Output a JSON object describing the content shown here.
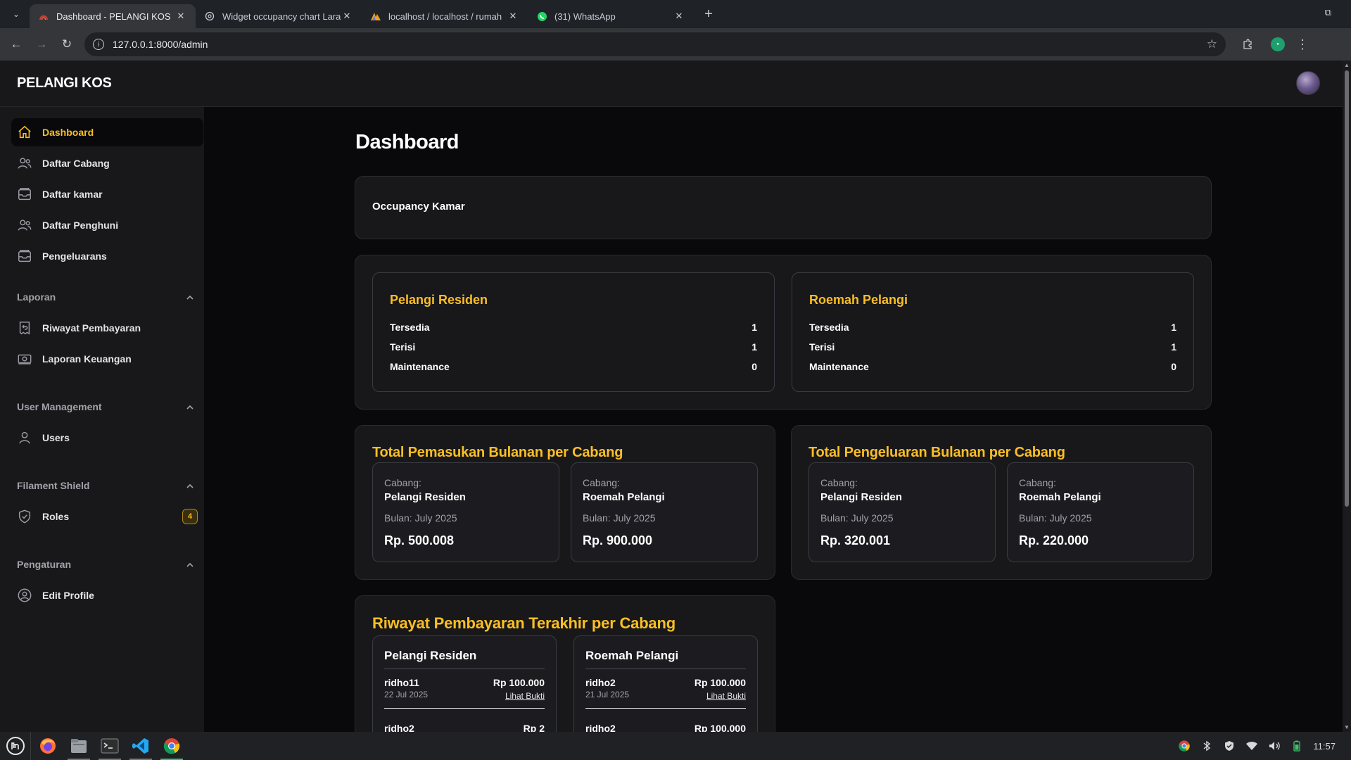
{
  "browser": {
    "tabs": [
      {
        "title": "Dashboard - PELANGI KOS",
        "icon": "pelangi-favicon",
        "active": true
      },
      {
        "title": "Widget occupancy chart Lara",
        "icon": "globe-icon",
        "active": false
      },
      {
        "title": "localhost / localhost / rumah",
        "icon": "phpmyadmin-icon",
        "active": false
      },
      {
        "title": "(31) WhatsApp",
        "icon": "whatsapp-icon",
        "active": false
      }
    ],
    "url": "127.0.0.1:8000/admin"
  },
  "app": {
    "brand": "PELANGI KOS",
    "accent": "#fbbf24"
  },
  "sidebar": {
    "items": [
      {
        "label": "Dashboard",
        "icon": "home-icon"
      },
      {
        "label": "Daftar Cabang",
        "icon": "users-icon"
      },
      {
        "label": "Daftar kamar",
        "icon": "inbox-icon"
      },
      {
        "label": "Daftar Penghuni",
        "icon": "users-icon"
      },
      {
        "label": "Pengeluarans",
        "icon": "inbox-icon"
      }
    ],
    "groups": [
      {
        "label": "Laporan",
        "items": [
          {
            "label": "Riwayat Pembayaran",
            "icon": "receipt-refund-icon"
          },
          {
            "label": "Laporan Keuangan",
            "icon": "banknotes-icon"
          }
        ]
      },
      {
        "label": "User Management",
        "items": [
          {
            "label": "Users",
            "icon": "user-icon"
          }
        ]
      },
      {
        "label": "Filament Shield",
        "items": [
          {
            "label": "Roles",
            "icon": "shield-check-icon",
            "badge": "4"
          }
        ]
      },
      {
        "label": "Pengaturan",
        "items": [
          {
            "label": "Edit Profile",
            "icon": "user-circle-icon"
          }
        ]
      }
    ]
  },
  "main": {
    "title": "Dashboard",
    "occupancy": {
      "title": "Occupancy Kamar",
      "branches": [
        {
          "name": "Pelangi Residen",
          "stats": [
            {
              "label": "Tersedia",
              "value": "1"
            },
            {
              "label": "Terisi",
              "value": "1"
            },
            {
              "label": "Maintenance",
              "value": "0"
            }
          ]
        },
        {
          "name": "Roemah Pelangi",
          "stats": [
            {
              "label": "Tersedia",
              "value": "1"
            },
            {
              "label": "Terisi",
              "value": "1"
            },
            {
              "label": "Maintenance",
              "value": "0"
            }
          ]
        }
      ]
    },
    "income": {
      "title": "Total Pemasukan Bulanan per Cabang",
      "cards": [
        {
          "label": "Cabang:",
          "name": "Pelangi Residen",
          "month": "Bulan: July 2025",
          "amount": "Rp. 500.008"
        },
        {
          "label": "Cabang:",
          "name": "Roemah Pelangi",
          "month": "Bulan: July 2025",
          "amount": "Rp. 900.000"
        }
      ]
    },
    "expense": {
      "title": "Total Pengeluaran Bulanan per Cabang",
      "cards": [
        {
          "label": "Cabang:",
          "name": "Pelangi Residen",
          "month": "Bulan: July 2025",
          "amount": "Rp. 320.001"
        },
        {
          "label": "Cabang:",
          "name": "Roemah Pelangi",
          "month": "Bulan: July 2025",
          "amount": "Rp. 220.000"
        }
      ]
    },
    "payments": {
      "title": "Riwayat Pembayaran Terakhir per Cabang",
      "branches": [
        {
          "name": "Pelangi Residen",
          "rows": [
            {
              "user": "ridho11",
              "date": "22 Jul 2025",
              "amount": "Rp 100.000",
              "link": "Lihat Bukti"
            },
            {
              "user": "ridho2",
              "date": "",
              "amount": "Rp 2",
              "link": ""
            }
          ]
        },
        {
          "name": "Roemah Pelangi",
          "rows": [
            {
              "user": "ridho2",
              "date": "21 Jul 2025",
              "amount": "Rp 100.000",
              "link": "Lihat Bukti"
            },
            {
              "user": "ridho2",
              "date": "",
              "amount": "Rp 100.000",
              "link": ""
            }
          ]
        }
      ]
    }
  },
  "taskbar": {
    "apps": [
      "firefox-icon",
      "files-icon",
      "terminal-icon",
      "vscode-icon",
      "chrome-icon"
    ],
    "clock": "11:57"
  }
}
